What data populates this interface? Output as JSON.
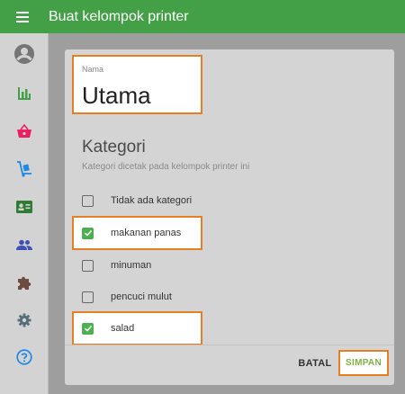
{
  "header": {
    "title": "Buat kelompok printer",
    "menu_icon": "hamburger-menu-icon"
  },
  "sidebar": {
    "items": [
      {
        "icon": "account-circle-icon",
        "color": "#757575"
      },
      {
        "icon": "bar-chart-icon",
        "color": "#43a047"
      },
      {
        "icon": "shopping-basket-icon",
        "color": "#e91e63"
      },
      {
        "icon": "dolly-cart-icon",
        "color": "#1e88e5"
      },
      {
        "icon": "contact-card-icon",
        "color": "#2e7d32"
      },
      {
        "icon": "people-icon",
        "color": "#3f51b5"
      },
      {
        "icon": "extension-puzzle-icon",
        "color": "#6d4c41"
      },
      {
        "icon": "settings-gear-icon",
        "color": "#546e7a"
      },
      {
        "icon": "help-circle-icon",
        "color": "#1e88e5"
      }
    ]
  },
  "form": {
    "name_label": "Nama",
    "name_value": "Utama",
    "section_title": "Kategori",
    "section_subtitle": "Kategori dicetak pada kelompok printer ini",
    "categories": [
      {
        "label": "Tidak ada kategori",
        "checked": false
      },
      {
        "label": "makanan panas",
        "checked": true
      },
      {
        "label": "minuman",
        "checked": false
      },
      {
        "label": "pencuci mulut",
        "checked": false
      },
      {
        "label": "salad",
        "checked": true
      }
    ]
  },
  "actions": {
    "cancel_label": "BATAL",
    "save_label": "SIMPAN"
  },
  "colors": {
    "app_bar": "#43a047",
    "highlight_border": "#e67e22",
    "checkbox_checked": "#4caf50",
    "save_text": "#7cb342"
  }
}
